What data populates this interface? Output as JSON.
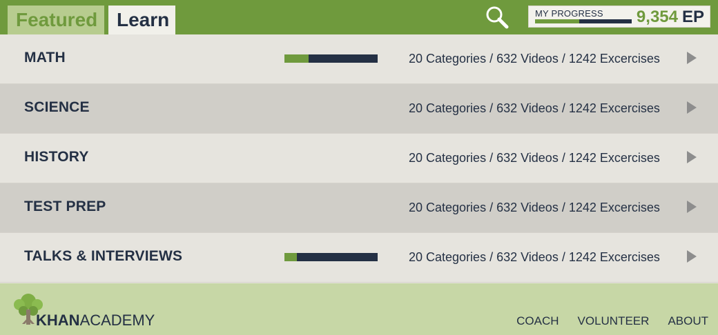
{
  "header": {
    "tabs": [
      {
        "label": "Featured",
        "active": false
      },
      {
        "label": "Learn",
        "active": true
      }
    ],
    "search_icon": "search-icon",
    "progress": {
      "label": "MY PROGRESS",
      "fraction": 0.46,
      "ep_value": "9,354",
      "ep_unit": "EP"
    }
  },
  "rows": [
    {
      "title": "MATH",
      "progress": 0.26,
      "show_bar": true,
      "meta": "20 Categories / 632 Videos / 1242 Excercises"
    },
    {
      "title": "SCIENCE",
      "progress": 0,
      "show_bar": false,
      "meta": "20 Categories / 632 Videos / 1242 Excercises"
    },
    {
      "title": "HISTORY",
      "progress": 0,
      "show_bar": false,
      "meta": "20 Categories / 632 Videos / 1242 Excercises"
    },
    {
      "title": "TEST PREP",
      "progress": 0,
      "show_bar": false,
      "meta": "20 Categories / 632 Videos / 1242 Excercises"
    },
    {
      "title": "TALKS & INTERVIEWS",
      "progress": 0.13,
      "show_bar": true,
      "meta": "20 Categories / 632 Videos / 1242 Excercises"
    }
  ],
  "footer": {
    "logo": {
      "brand_bold": "KHAN",
      "brand_light": "ACADEMY"
    },
    "links": [
      "COACH",
      "VOLUNTEER",
      "ABOUT"
    ]
  },
  "colors": {
    "brand_green": "#6f9a3d",
    "navy": "#243044",
    "footer_bg": "#c7d7a6",
    "row_light": "#e6e4de",
    "row_dark": "#d0cec8"
  }
}
